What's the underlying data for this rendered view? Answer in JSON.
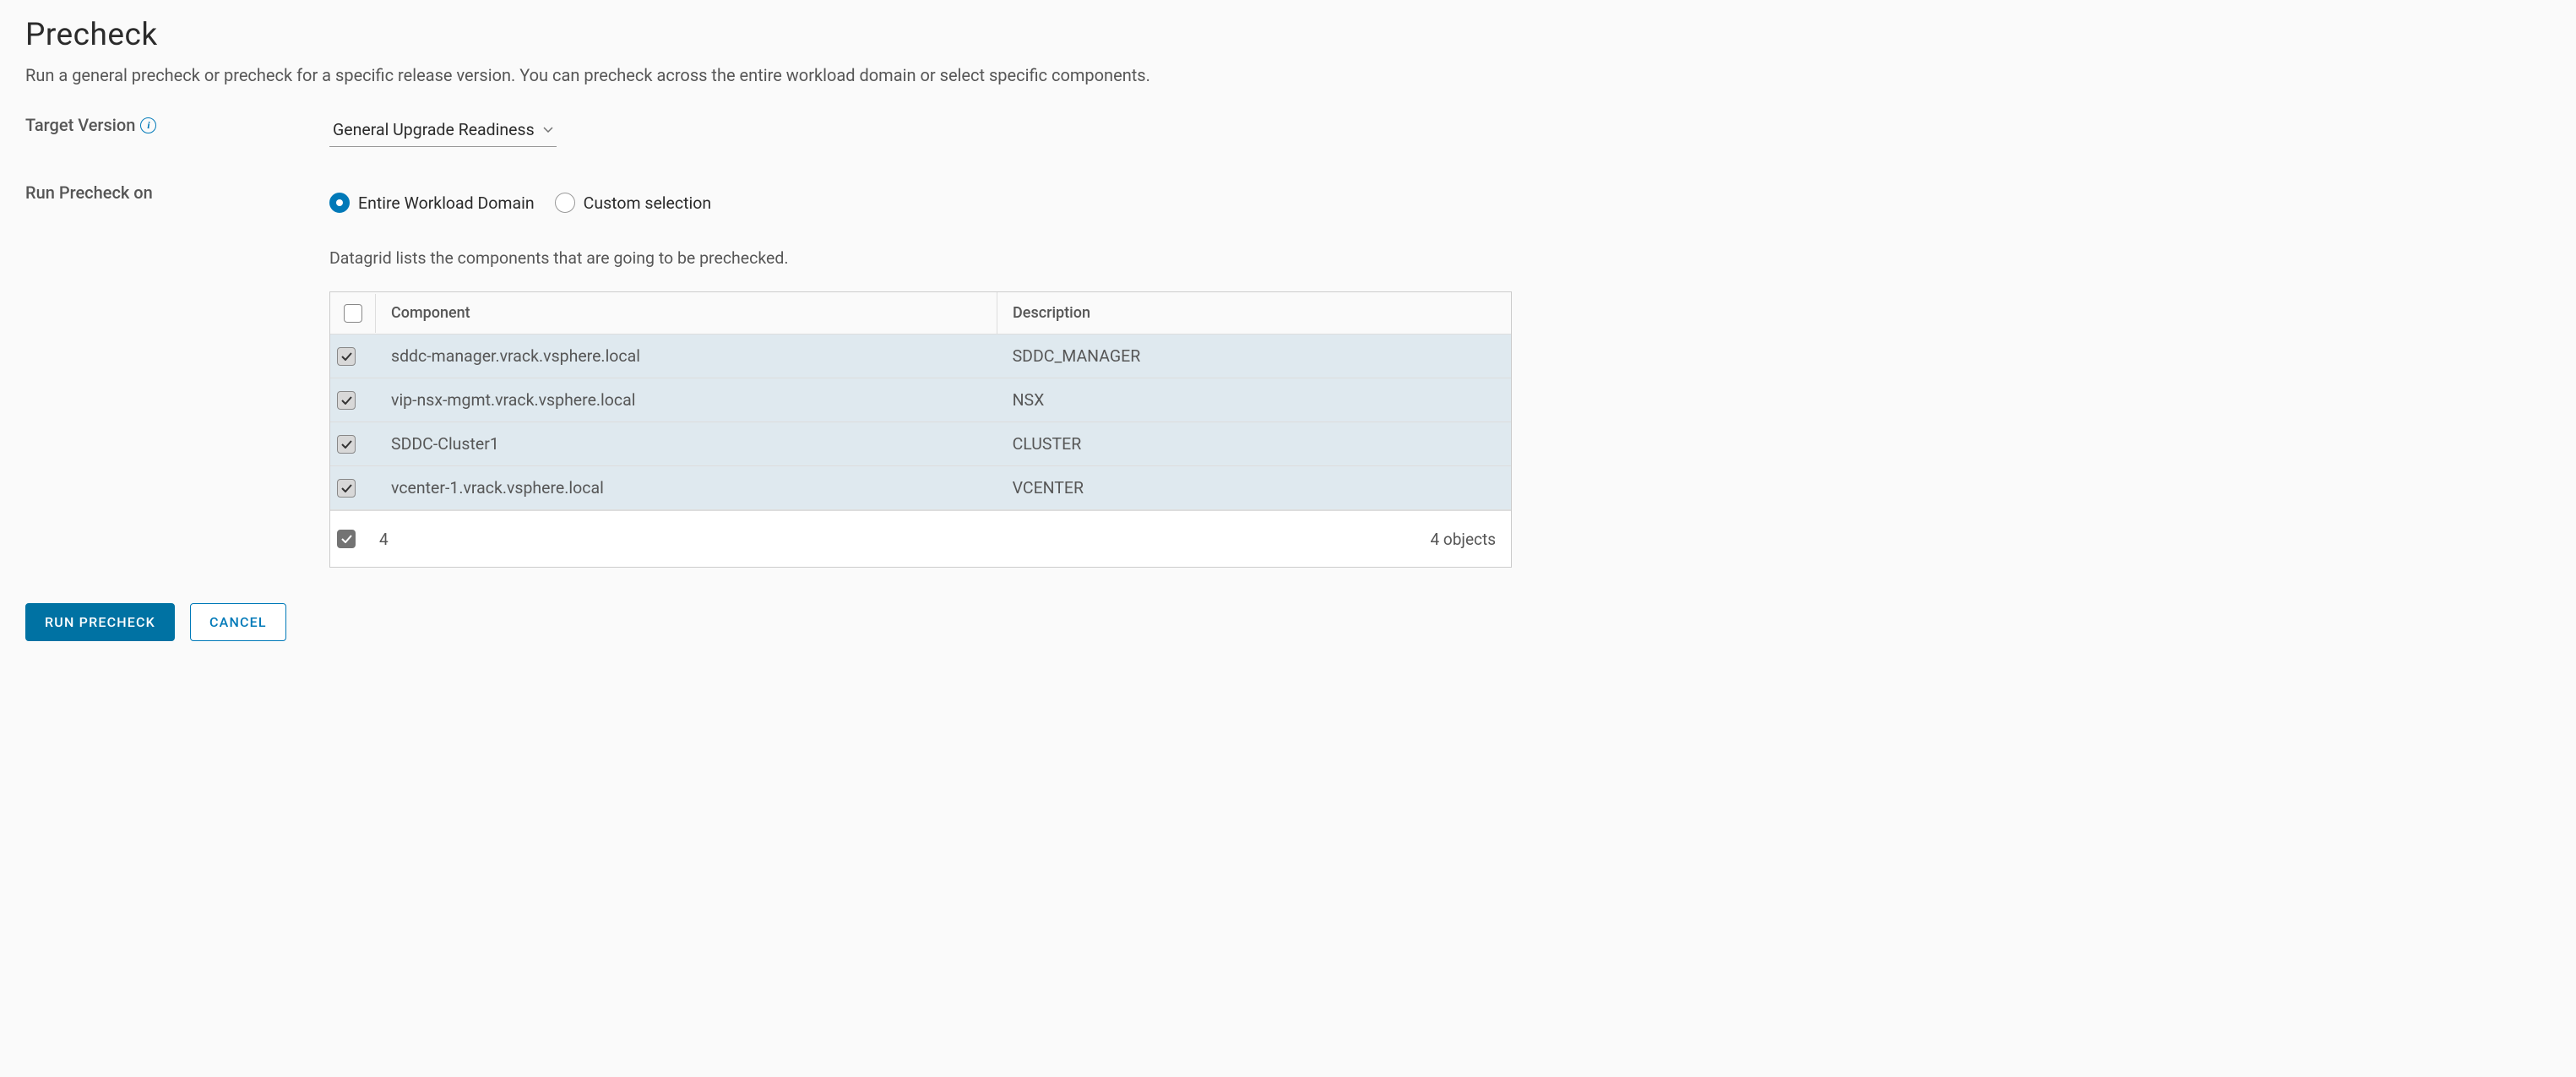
{
  "title": "Precheck",
  "description": "Run a general precheck or precheck for a specific release version. You can precheck across the entire workload domain or select specific components.",
  "labels": {
    "targetVersion": "Target Version",
    "runPrecheckOn": "Run Precheck on"
  },
  "targetVersion": {
    "selected": "General Upgrade Readiness"
  },
  "runOn": {
    "options": [
      {
        "label": "Entire Workload Domain",
        "selected": true
      },
      {
        "label": "Custom selection",
        "selected": false
      }
    ]
  },
  "datagrid": {
    "description": "Datagrid lists the components that are going to be prechecked.",
    "columns": {
      "component": "Component",
      "description": "Description"
    },
    "rows": [
      {
        "checked": true,
        "component": "sddc-manager.vrack.vsphere.local",
        "description": "SDDC_MANAGER"
      },
      {
        "checked": true,
        "component": "vip-nsx-mgmt.vrack.vsphere.local",
        "description": "NSX"
      },
      {
        "checked": true,
        "component": "SDDC-Cluster1",
        "description": "CLUSTER"
      },
      {
        "checked": true,
        "component": "vcenter-1.vrack.vsphere.local",
        "description": "VCENTER"
      }
    ],
    "footer": {
      "selectedCount": "4",
      "totalText": "4 objects"
    }
  },
  "buttons": {
    "run": "RUN PRECHECK",
    "cancel": "CANCEL"
  }
}
